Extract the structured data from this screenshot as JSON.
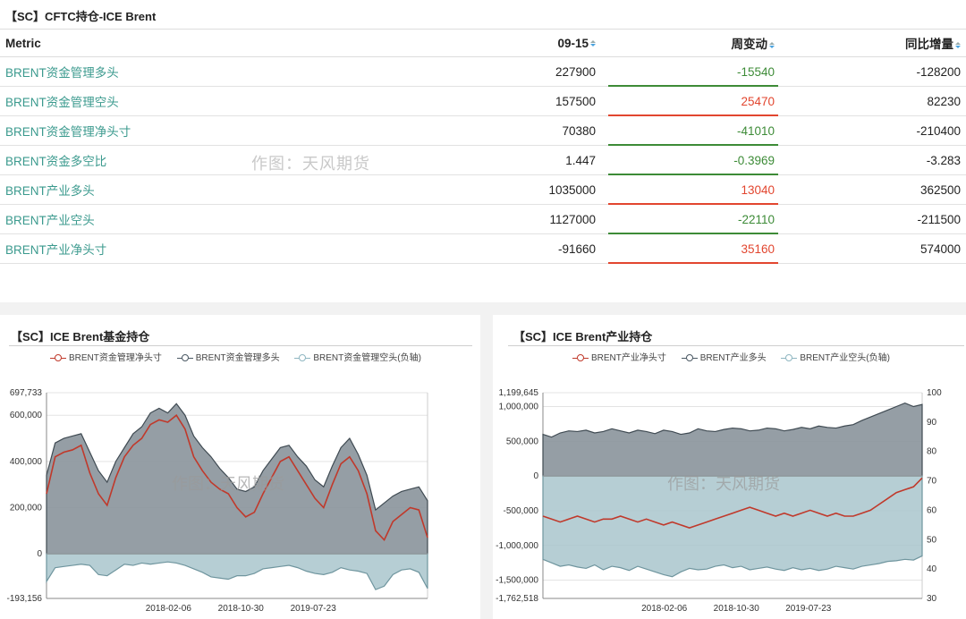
{
  "table": {
    "title": "【SC】CFTC持仓-ICE Brent",
    "columns": [
      "Metric",
      "09-15",
      "周变动",
      "同比增量"
    ],
    "rows": [
      {
        "metric": "BRENT资金管理多头",
        "value": "227900",
        "change": "-15540",
        "yoy": "-128200",
        "dir": "down"
      },
      {
        "metric": "BRENT资金管理空头",
        "value": "157500",
        "change": "25470",
        "yoy": "82230",
        "dir": "up"
      },
      {
        "metric": "BRENT资金管理净头寸",
        "value": "70380",
        "change": "-41010",
        "yoy": "-210400",
        "dir": "down"
      },
      {
        "metric": "BRENT资金多空比",
        "value": "1.447",
        "change": "-0.3969",
        "yoy": "-3.283",
        "dir": "down"
      },
      {
        "metric": "BRENT产业多头",
        "value": "1035000",
        "change": "13040",
        "yoy": "362500",
        "dir": "up"
      },
      {
        "metric": "BRENT产业空头",
        "value": "1127000",
        "change": "-22110",
        "yoy": "-211500",
        "dir": "down"
      },
      {
        "metric": "BRENT产业净头寸",
        "value": "-91660",
        "change": "35160",
        "yoy": "574000",
        "dir": "up"
      }
    ],
    "watermark": "作图：天风期货"
  },
  "colors": {
    "up": "#e2462f",
    "down": "#3d8b37",
    "net": "#c0392b",
    "long": "#4a5863",
    "short": "#8fb6c1"
  },
  "chart_data": [
    {
      "type": "area",
      "title": "【SC】ICE Brent基金持仓",
      "watermark": "作图：天风期货",
      "x_ticks": [
        "2018-02-06",
        "2018-10-30",
        "2019-07-23"
      ],
      "y_ticks": [
        "697,733",
        "600,000",
        "400,000",
        "200,000",
        "0",
        "-193,156"
      ],
      "ylim": [
        -193156,
        697733
      ],
      "series": [
        {
          "name": "BRENT资金管理净头寸",
          "kind": "line",
          "values": [
            260000,
            420000,
            440000,
            450000,
            470000,
            350000,
            260000,
            210000,
            330000,
            420000,
            470000,
            500000,
            560000,
            580000,
            570000,
            600000,
            540000,
            420000,
            360000,
            310000,
            280000,
            260000,
            200000,
            160000,
            180000,
            260000,
            330000,
            400000,
            420000,
            360000,
            300000,
            240000,
            200000,
            300000,
            390000,
            420000,
            360000,
            260000,
            100000,
            60000,
            140000,
            170000,
            200000,
            190000,
            70000
          ]
        },
        {
          "name": "BRENT资金管理多头",
          "kind": "area",
          "values": [
            340000,
            480000,
            500000,
            510000,
            520000,
            440000,
            360000,
            310000,
            400000,
            460000,
            520000,
            550000,
            610000,
            630000,
            610000,
            650000,
            600000,
            510000,
            460000,
            420000,
            370000,
            330000,
            280000,
            270000,
            290000,
            360000,
            410000,
            460000,
            470000,
            420000,
            380000,
            320000,
            290000,
            380000,
            460000,
            500000,
            430000,
            340000,
            190000,
            220000,
            250000,
            270000,
            280000,
            290000,
            230000
          ]
        },
        {
          "name": "BRENT资金管理空头(负轴)",
          "kind": "area",
          "values": [
            -120000,
            -60000,
            -55000,
            -50000,
            -45000,
            -50000,
            -90000,
            -95000,
            -70000,
            -45000,
            -50000,
            -40000,
            -45000,
            -40000,
            -35000,
            -40000,
            -50000,
            -65000,
            -80000,
            -100000,
            -105000,
            -110000,
            -95000,
            -95000,
            -85000,
            -65000,
            -60000,
            -55000,
            -50000,
            -60000,
            -75000,
            -85000,
            -90000,
            -80000,
            -60000,
            -70000,
            -75000,
            -85000,
            -155000,
            -140000,
            -90000,
            -70000,
            -65000,
            -80000,
            -150000
          ]
        }
      ]
    },
    {
      "type": "area",
      "title": "【SC】ICE Brent产业持仓",
      "watermark": "作图：天风期货",
      "x_ticks": [
        "2018-02-06",
        "2018-10-30",
        "2019-07-23"
      ],
      "y_ticks_left": [
        "1,199,645",
        "1,000,000",
        "500,000",
        "0",
        "-500,000",
        "-1,000,000",
        "-1,500,000",
        "-1,762,518"
      ],
      "y_ticks_right": [
        "100",
        "90",
        "80",
        "70",
        "60",
        "50",
        "40",
        "30"
      ],
      "ylim": [
        -1762518,
        1199645
      ],
      "y2lim": [
        30,
        100
      ],
      "series": [
        {
          "name": "BRENT产业净头寸",
          "kind": "line",
          "axis": "right",
          "values": [
            58,
            57,
            56,
            57,
            58,
            57,
            56,
            57,
            57,
            58,
            57,
            56,
            57,
            56,
            55,
            56,
            55,
            54,
            55,
            56,
            57,
            58,
            59,
            60,
            61,
            60,
            59,
            58,
            59,
            58,
            59,
            60,
            59,
            58,
            59,
            58,
            58,
            59,
            60,
            62,
            64,
            66,
            67,
            68,
            71
          ]
        },
        {
          "name": "BRENT产业多头",
          "kind": "area",
          "values": [
            600000,
            560000,
            620000,
            650000,
            640000,
            660000,
            620000,
            640000,
            680000,
            650000,
            620000,
            660000,
            640000,
            610000,
            660000,
            640000,
            600000,
            620000,
            680000,
            650000,
            640000,
            670000,
            690000,
            680000,
            650000,
            660000,
            690000,
            680000,
            650000,
            670000,
            700000,
            680000,
            720000,
            700000,
            690000,
            720000,
            740000,
            800000,
            850000,
            900000,
            950000,
            1000000,
            1050000,
            1000000,
            1030000
          ]
        },
        {
          "name": "BRENT产业空头(负轴)",
          "kind": "area",
          "values": [
            -1200000,
            -1250000,
            -1300000,
            -1280000,
            -1310000,
            -1330000,
            -1280000,
            -1350000,
            -1300000,
            -1320000,
            -1360000,
            -1300000,
            -1340000,
            -1380000,
            -1420000,
            -1450000,
            -1380000,
            -1330000,
            -1350000,
            -1340000,
            -1300000,
            -1280000,
            -1320000,
            -1300000,
            -1350000,
            -1330000,
            -1310000,
            -1340000,
            -1360000,
            -1320000,
            -1350000,
            -1330000,
            -1360000,
            -1340000,
            -1300000,
            -1320000,
            -1340000,
            -1300000,
            -1280000,
            -1260000,
            -1230000,
            -1220000,
            -1200000,
            -1210000,
            -1150000
          ]
        }
      ]
    }
  ]
}
